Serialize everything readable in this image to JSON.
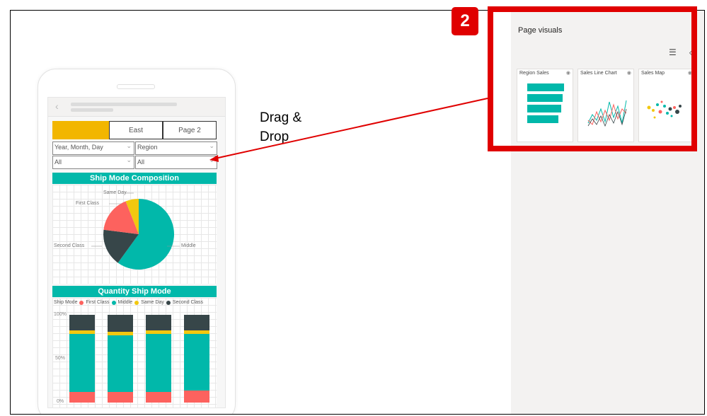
{
  "callout": {
    "number": "2",
    "drag_line1": "Drag &",
    "drag_line2": "Drop"
  },
  "phone": {
    "tabs": [
      {
        "label": ""
      },
      {
        "label": "East"
      },
      {
        "label": "Page 2"
      }
    ],
    "slicers": [
      {
        "label": "Year, Month, Day",
        "value": "All"
      },
      {
        "label": "Region",
        "value": "All"
      }
    ],
    "pie": {
      "title": "Ship Mode Composition",
      "labels": {
        "same_day": "Same Day",
        "first_class": "First Class",
        "second_class": "Second Class",
        "middle": "Middle"
      }
    },
    "stacked": {
      "title": "Quantity Ship Mode",
      "legend_title": "Ship Mode",
      "legend": [
        {
          "name": "First Class",
          "color": "#fd625e"
        },
        {
          "name": "Middle",
          "color": "#01b8aa"
        },
        {
          "name": "Same Day",
          "color": "#f2c80f"
        },
        {
          "name": "Second Class",
          "color": "#374649"
        }
      ],
      "ticks": {
        "top": "100%",
        "mid": "50%",
        "bottom": "0%"
      }
    }
  },
  "panel": {
    "title": "Page visuals",
    "visuals": [
      {
        "title": "Region Sales"
      },
      {
        "title": "Sales Line Chart"
      },
      {
        "title": "Sales Map"
      }
    ]
  },
  "colors": {
    "accent": "#01b8aa",
    "highlight": "#e00000",
    "tab_active": "#f2b600"
  },
  "chart_data": [
    {
      "type": "pie",
      "title": "Ship Mode Composition",
      "categories": [
        "Middle",
        "Second Class",
        "First Class",
        "Same Day"
      ],
      "values": [
        60,
        17,
        17,
        6
      ]
    },
    {
      "type": "bar",
      "title": "Quantity Ship Mode",
      "ylim": [
        0,
        100
      ],
      "categories": [
        "",
        "",
        "",
        ""
      ],
      "series": [
        {
          "name": "First Class",
          "values": [
            12,
            12,
            12,
            14
          ]
        },
        {
          "name": "Middle",
          "values": [
            66,
            65,
            66,
            64
          ]
        },
        {
          "name": "Same Day",
          "values": [
            4,
            4,
            4,
            4
          ]
        },
        {
          "name": "Second Class",
          "values": [
            18,
            19,
            18,
            18
          ]
        }
      ]
    }
  ]
}
